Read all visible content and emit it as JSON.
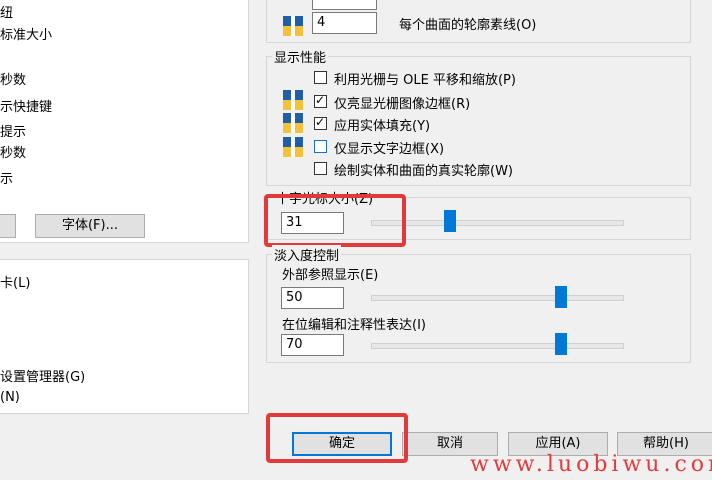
{
  "left_panel": {
    "lines": [
      "纽",
      "标准大小",
      "秒数",
      "示快捷键",
      "提示",
      "秒数",
      "示"
    ],
    "font_button": "字体(F)...",
    "lower_lines": [
      "卡(L)",
      "设置管理器(G)",
      "(N)"
    ]
  },
  "right_top": {
    "contour_value": "4",
    "contour_label": "每个曲面的轮廓素线(O)"
  },
  "display_performance": {
    "title": "显示性能",
    "options": [
      {
        "label": "利用光栅与 OLE 平移和缩放(P)",
        "checked": false
      },
      {
        "label": "仅亮显光栅图像边框(R)",
        "checked": true
      },
      {
        "label": "应用实体填充(Y)",
        "checked": true
      },
      {
        "label": "仅显示文字边框(X)",
        "checked": false
      },
      {
        "label": "绘制实体和曲面的真实轮廓(W)",
        "checked": false
      }
    ]
  },
  "crosshair": {
    "title": "十字光标大小(Z)",
    "value": "31"
  },
  "fade": {
    "title": "淡入度控制",
    "xref_label": "外部参照显示(E)",
    "xref_value": "50",
    "inplace_label": "在位编辑和注释性表达(I)",
    "inplace_value": "70"
  },
  "buttons": {
    "ok": "确定",
    "cancel": "取消",
    "apply": "应用(A)",
    "help": "帮助(H)"
  },
  "watermark": "www.luobiwu.com"
}
